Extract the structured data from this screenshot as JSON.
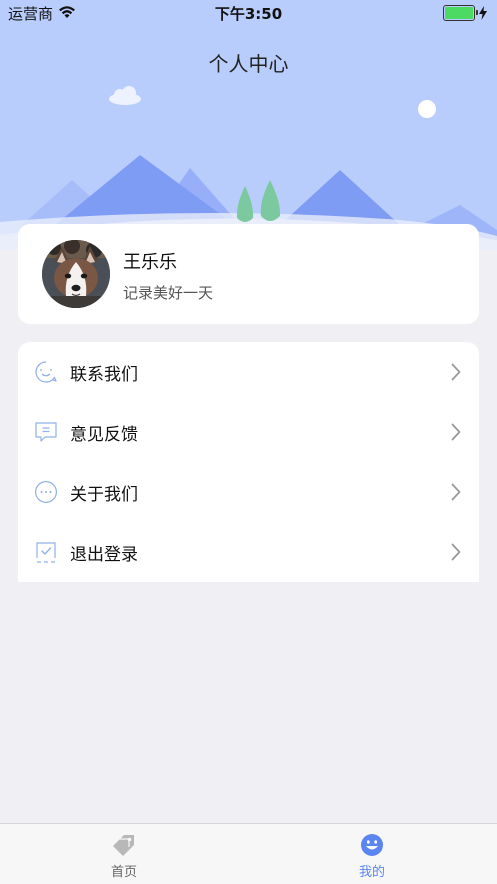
{
  "status_bar": {
    "carrier": "运营商",
    "time": "下午3:50",
    "battery_level": 1.0
  },
  "header": {
    "title": "个人中心"
  },
  "profile": {
    "name": "王乐乐",
    "motto": "记录美好一天",
    "avatar_icon": "husky-avatar"
  },
  "menu": {
    "items": [
      {
        "label": "联系我们",
        "icon": "smile-bubble-icon"
      },
      {
        "label": "意见反馈",
        "icon": "feedback-message-icon"
      },
      {
        "label": "关于我们",
        "icon": "more-dots-icon"
      },
      {
        "label": "退出登录",
        "icon": "checkbox-logout-icon"
      }
    ]
  },
  "tabbar": {
    "tabs": [
      {
        "label": "首页",
        "icon": "tag-icon",
        "active": false
      },
      {
        "label": "我的",
        "icon": "smiley-face-icon",
        "active": true
      }
    ]
  },
  "colors": {
    "header_bg": "#b9cdfc",
    "accent": "#5b86f2",
    "page_bg": "#efeff4"
  }
}
